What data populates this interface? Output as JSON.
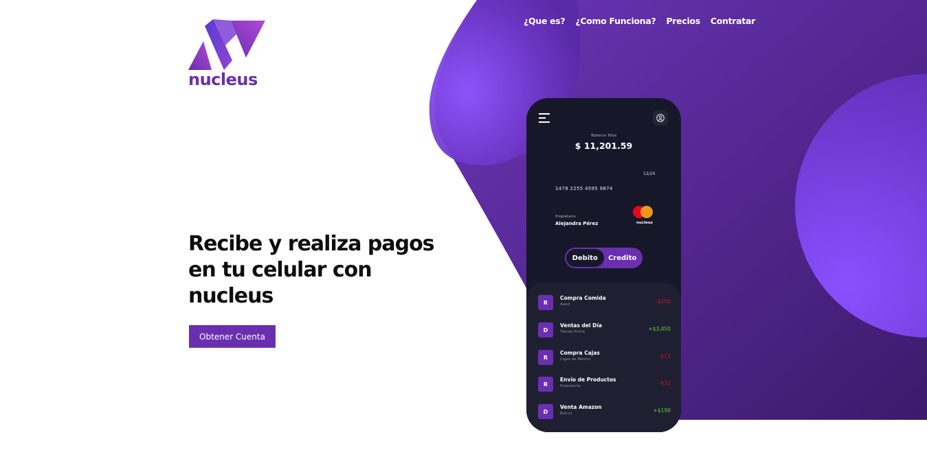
{
  "brand": {
    "name": "nucleus",
    "primary_color": "#6a2fb0",
    "accent_color": "#8b52ff"
  },
  "nav": {
    "items": [
      "¿Que es?",
      "¿Como Funciona?",
      "Precios",
      "Contratar"
    ]
  },
  "hero": {
    "title_lines": [
      "Recibe y realiza pagos",
      "en tu celular con",
      "nucleus"
    ],
    "cta_label": "Obtener Cuenta"
  },
  "phone": {
    "menu_icon": "hamburger-icon",
    "profile_icon": "user-icon",
    "balance_label": "Balance Total",
    "balance_value": "$ 11,201.59",
    "card": {
      "expiry": "12/24",
      "number": "1478 2255 4595 9874",
      "owner_label": "Propietario",
      "owner_name": "Alejandra Pérez",
      "brand": "nucleus"
    },
    "toggle": {
      "debit": "Debito",
      "credit": "Credito",
      "active": "Debito"
    },
    "transactions": [
      {
        "initial": "R",
        "title": "Compra Comida",
        "subtitle": "Awell",
        "amount": "-$150",
        "type": "neg"
      },
      {
        "initial": "D",
        "title": "Ventas del Día",
        "subtitle": "Tienda Prima",
        "amount": "+$3,050",
        "type": "pos"
      },
      {
        "initial": "R",
        "title": "Compra Cajas",
        "subtitle": "Cajas de México",
        "amount": "-$12",
        "type": "neg"
      },
      {
        "initial": "R",
        "title": "Envío de Productos",
        "subtitle": "Paquetería",
        "amount": "-$32",
        "type": "neg"
      },
      {
        "initial": "D",
        "title": "Venta Amazon",
        "subtitle": "Banco",
        "amount": "+$199",
        "type": "pos"
      }
    ]
  }
}
